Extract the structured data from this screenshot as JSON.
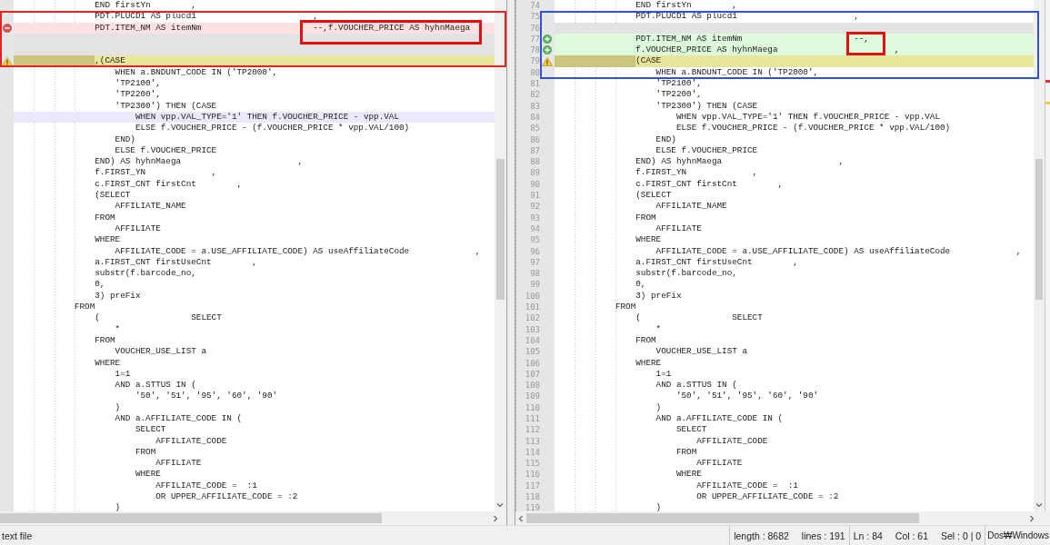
{
  "left": {
    "lines": [
      {
        "kind": "normal",
        "text": "                END firstYn        ,"
      },
      {
        "kind": "normal",
        "text": "                PDT.PLUCD1 AS plucd1                       ,"
      },
      {
        "kind": "removed",
        "text": "                PDT.ITEM_NM AS itemNm                      --,f.VOUCHER_PRICE AS hyhnMaega"
      },
      {
        "kind": "filler"
      },
      {
        "kind": "filler"
      },
      {
        "kind": "indent-changed",
        "text": "                ,(CASE"
      },
      {
        "kind": "normal",
        "text": "                    WHEN a.BNDUNT_CODE IN ('TP2000',"
      },
      {
        "kind": "normal",
        "text": "                    'TP2100',"
      },
      {
        "kind": "normal",
        "text": "                    'TP2200',"
      },
      {
        "kind": "normal",
        "text": "                    'TP2300') THEN (CASE"
      },
      {
        "kind": "current",
        "text": "                        WHEN vpp.VAL_TYPE='1' THEN f.VOUCHER_PRICE - vpp.VAL"
      },
      {
        "kind": "normal",
        "text": "                        ELSE f.VOUCHER_PRICE - (f.VOUCHER_PRICE * vpp.VAL/100)"
      },
      {
        "kind": "normal",
        "text": "                    END)"
      },
      {
        "kind": "normal",
        "text": "                    ELSE f.VOUCHER_PRICE"
      },
      {
        "kind": "normal",
        "text": "                END) AS hyhnMaega                       ,"
      },
      {
        "kind": "normal",
        "text": "                f.FIRST_YN             ,"
      },
      {
        "kind": "normal",
        "text": "                c.FIRST_CNT firstCnt        ,"
      },
      {
        "kind": "normal",
        "text": "                (SELECT"
      },
      {
        "kind": "normal",
        "text": "                    AFFILIATE_NAME"
      },
      {
        "kind": "normal",
        "text": "                FROM"
      },
      {
        "kind": "normal",
        "text": "                    AFFILIATE"
      },
      {
        "kind": "normal",
        "text": "                WHERE"
      },
      {
        "kind": "normal",
        "text": "                    AFFILIATE_CODE = a.USE_AFFILIATE_CODE) AS useAffiliateCode             ,"
      },
      {
        "kind": "normal",
        "text": "                a.FIRST_CNT firstUseCnt        ,"
      },
      {
        "kind": "normal",
        "text": "                substr(f.barcode_no,"
      },
      {
        "kind": "normal",
        "text": "                0,"
      },
      {
        "kind": "normal",
        "text": "                3) preFix"
      },
      {
        "kind": "normal",
        "text": "            FROM"
      },
      {
        "kind": "normal",
        "text": "                (                  SELECT"
      },
      {
        "kind": "normal",
        "text": "                    *"
      },
      {
        "kind": "normal",
        "text": "                FROM"
      },
      {
        "kind": "normal",
        "text": "                    VOUCHER_USE_LIST a"
      },
      {
        "kind": "normal",
        "text": "                WHERE"
      },
      {
        "kind": "normal",
        "text": "                    1=1"
      },
      {
        "kind": "normal",
        "text": "                    AND a.STTUS IN ("
      },
      {
        "kind": "normal",
        "text": "                        '50', '51', '95', '60', '90'"
      },
      {
        "kind": "normal",
        "text": "                    )"
      },
      {
        "kind": "normal",
        "text": "                    AND a.AFFILIATE_CODE IN ("
      },
      {
        "kind": "normal",
        "text": "                        SELECT"
      },
      {
        "kind": "normal",
        "text": "                            AFFILIATE_CODE"
      },
      {
        "kind": "normal",
        "text": "                        FROM"
      },
      {
        "kind": "normal",
        "text": "                            AFFILIATE"
      },
      {
        "kind": "normal",
        "text": "                        WHERE"
      },
      {
        "kind": "normal",
        "text": "                            AFFILIATE_CODE =  :1"
      },
      {
        "kind": "normal",
        "text": "                            OR UPPER_AFFILIATE_CODE = :2"
      },
      {
        "kind": "normal",
        "text": "                    )"
      }
    ]
  },
  "right": {
    "lines": [
      {
        "number": "74",
        "kind": "normal",
        "text": "                END firstYn        ,"
      },
      {
        "number": "75",
        "kind": "normal",
        "text": "                PDT.PLUCD1 AS plucd1                       ,"
      },
      {
        "number": "76",
        "kind": "filler"
      },
      {
        "number": "77",
        "kind": "added",
        "text": "                PDT.ITEM_NM AS itemNm                      --,"
      },
      {
        "number": "78",
        "kind": "added",
        "text": "                f.VOUCHER_PRICE AS hyhnMaega                       ,"
      },
      {
        "number": "79",
        "kind": "indent-changed",
        "text": "                (CASE"
      },
      {
        "number": "80",
        "kind": "normal",
        "text": "                    WHEN a.BNDUNT_CODE IN ('TP2000',"
      },
      {
        "number": "81",
        "kind": "normal",
        "text": "                    'TP2100',"
      },
      {
        "number": "82",
        "kind": "normal",
        "text": "                    'TP2200',"
      },
      {
        "number": "83",
        "kind": "normal",
        "text": "                    'TP2300') THEN (CASE"
      },
      {
        "number": "84",
        "kind": "normal",
        "text": "                        WHEN vpp.VAL_TYPE='1' THEN f.VOUCHER_PRICE - vpp.VAL"
      },
      {
        "number": "85",
        "kind": "normal",
        "text": "                        ELSE f.VOUCHER_PRICE - (f.VOUCHER_PRICE * vpp.VAL/100)"
      },
      {
        "number": "86",
        "kind": "normal",
        "text": "                    END)"
      },
      {
        "number": "87",
        "kind": "normal",
        "text": "                    ELSE f.VOUCHER_PRICE"
      },
      {
        "number": "88",
        "kind": "normal",
        "text": "                END) AS hyhnMaega                       ,"
      },
      {
        "number": "89",
        "kind": "normal",
        "text": "                f.FIRST_YN             ,"
      },
      {
        "number": "90",
        "kind": "normal",
        "text": "                c.FIRST_CNT firstCnt        ,"
      },
      {
        "number": "91",
        "kind": "normal",
        "text": "                (SELECT"
      },
      {
        "number": "92",
        "kind": "normal",
        "text": "                    AFFILIATE_NAME"
      },
      {
        "number": "93",
        "kind": "normal",
        "text": "                FROM"
      },
      {
        "number": "94",
        "kind": "normal",
        "text": "                    AFFILIATE"
      },
      {
        "number": "95",
        "kind": "normal",
        "text": "                WHERE"
      },
      {
        "number": "96",
        "kind": "normal",
        "text": "                    AFFILIATE_CODE = a.USE_AFFILIATE_CODE) AS useAffiliateCode             ,"
      },
      {
        "number": "97",
        "kind": "normal",
        "text": "                a.FIRST_CNT firstUseCnt        ,"
      },
      {
        "number": "98",
        "kind": "normal",
        "text": "                substr(f.barcode_no,"
      },
      {
        "number": "99",
        "kind": "normal",
        "text": "                0,"
      },
      {
        "number": "100",
        "kind": "normal",
        "text": "                3) preFix"
      },
      {
        "number": "101",
        "kind": "normal",
        "text": "            FROM"
      },
      {
        "number": "102",
        "kind": "normal",
        "text": "                (                  SELECT"
      },
      {
        "number": "103",
        "kind": "normal",
        "text": "                    *"
      },
      {
        "number": "104",
        "kind": "normal",
        "text": "                FROM"
      },
      {
        "number": "105",
        "kind": "normal",
        "text": "                    VOUCHER_USE_LIST a"
      },
      {
        "number": "106",
        "kind": "normal",
        "text": "                WHERE"
      },
      {
        "number": "107",
        "kind": "normal",
        "text": "                    1=1"
      },
      {
        "number": "108",
        "kind": "normal",
        "text": "                    AND a.STTUS IN ("
      },
      {
        "number": "109",
        "kind": "normal",
        "text": "                        '50', '51', '95', '60', '90'"
      },
      {
        "number": "110",
        "kind": "normal",
        "text": "                    )"
      },
      {
        "number": "111",
        "kind": "normal",
        "text": "                    AND a.AFFILIATE_CODE IN ("
      },
      {
        "number": "112",
        "kind": "normal",
        "text": "                        SELECT"
      },
      {
        "number": "113",
        "kind": "normal",
        "text": "                            AFFILIATE_CODE"
      },
      {
        "number": "114",
        "kind": "normal",
        "text": "                        FROM"
      },
      {
        "number": "115",
        "kind": "normal",
        "text": "                            AFFILIATE"
      },
      {
        "number": "116",
        "kind": "normal",
        "text": "                        WHERE"
      },
      {
        "number": "117",
        "kind": "normal",
        "text": "                            AFFILIATE_CODE =  :1"
      },
      {
        "number": "118",
        "kind": "normal",
        "text": "                            OR UPPER_AFFILIATE_CODE = :2"
      },
      {
        "number": "119",
        "kind": "normal",
        "text": "                    )"
      }
    ]
  },
  "status_bar": {
    "file_type": "text file",
    "sections": [
      {
        "items": [
          "length : 8682",
          "lines : 191"
        ]
      },
      {
        "items": [
          "Ln : 84",
          "Col : 61",
          "Sel : 0 | 0"
        ]
      },
      {
        "items": [
          "Dos₩Windows"
        ]
      }
    ]
  }
}
